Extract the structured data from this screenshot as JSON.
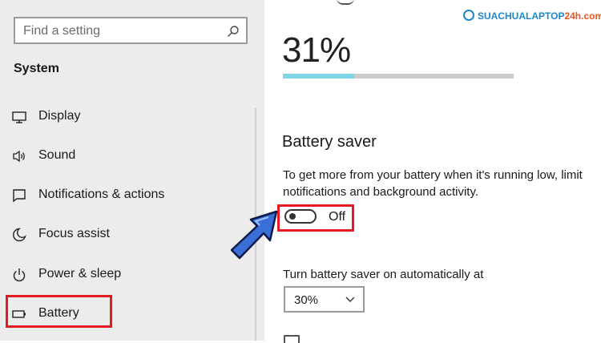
{
  "sidebar": {
    "search_placeholder": "Find a setting",
    "section_title": "System",
    "items": [
      {
        "label": "Display",
        "icon": "monitor-icon"
      },
      {
        "label": "Sound",
        "icon": "speaker-icon"
      },
      {
        "label": "Notifications & actions",
        "icon": "notification-icon"
      },
      {
        "label": "Focus assist",
        "icon": "moon-icon"
      },
      {
        "label": "Power & sleep",
        "icon": "power-icon"
      },
      {
        "label": "Battery",
        "icon": "battery-icon"
      }
    ],
    "active_item": "Battery"
  },
  "main": {
    "battery_percent_text": "31%",
    "battery_level": 0.31,
    "battery_saver": {
      "title": "Battery saver",
      "description": "To get more from your battery when it's running low, limit notifications and background activity.",
      "toggle_state_label": "Off",
      "toggle_on": false
    },
    "auto_threshold": {
      "label": "Turn battery saver on automatically at",
      "selected_value": "30%"
    }
  },
  "watermark": {
    "logo_text_main": "SUACHUALAPTOP",
    "logo_text_accent": "24h.com"
  },
  "colors": {
    "highlight_red": "#e41b23",
    "battery_fill": "#7fd4e6",
    "arrow_blue": "#3a6fd8",
    "logo_blue": "#1e88c8"
  }
}
